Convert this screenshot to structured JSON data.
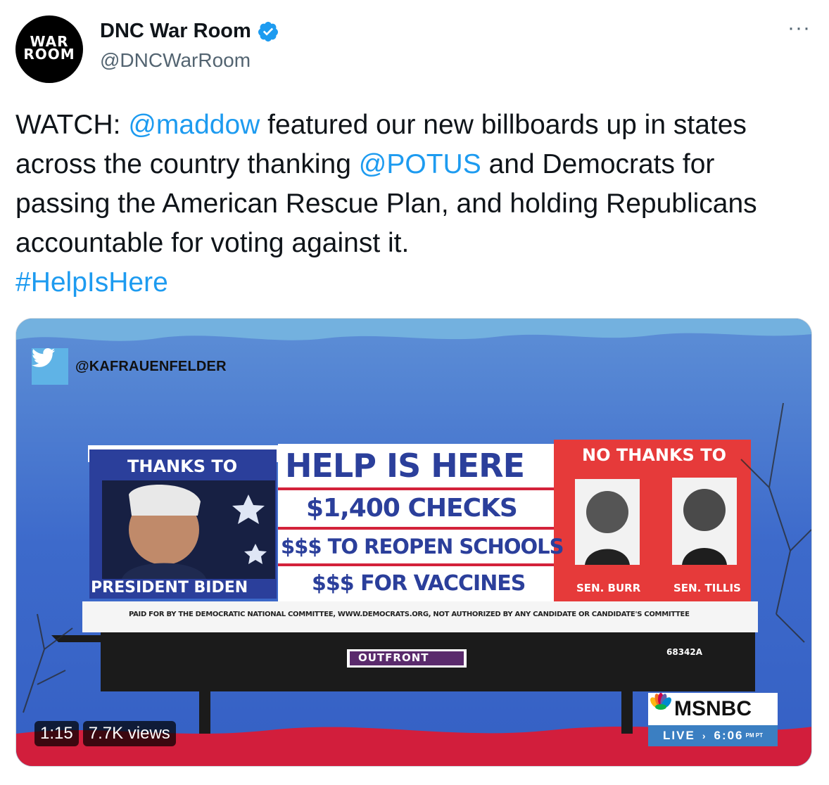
{
  "author": {
    "display_name": "DNC War Room",
    "handle": "@DNCWarRoom",
    "avatar_text_line1": "WAR",
    "avatar_text_line2": "ROOM",
    "verified_icon": "verified-badge-icon"
  },
  "more_menu_label": "···",
  "tweet": {
    "part1": "WATCH: ",
    "mention1": "@maddow",
    "part2": " featured our new billboards up in states across the country thanking ",
    "mention2": "@POTUS",
    "part3": " and Democrats for passing the American Rescue Plan, and holding Republicans accountable for voting against it.",
    "hashtag": "#HelpIsHere"
  },
  "media": {
    "watermark_handle": "@KAFRAUENFELDER",
    "billboard": {
      "thanks_to": "THANKS TO",
      "president": "PRESIDENT BIDEN",
      "headline": "HELP IS HERE",
      "line1": "$1,400 CHECKS",
      "line2": "$$$ TO REOPEN SCHOOLS",
      "line3": "$$$ FOR VACCINES",
      "no_thanks": "NO THANKS TO",
      "senator1": "SEN. BURR",
      "senator2": "SEN. TILLIS",
      "paid_for": "PAID FOR BY THE DEMOCRATIC NATIONAL COMMITTEE, WWW.DEMOCRATS.ORG, NOT AUTHORIZED BY ANY CANDIDATE OR CANDIDATE'S COMMITTEE",
      "vendor": "OUTFRONT",
      "panel_id": "68342A"
    },
    "network": "MSNBC",
    "live_label": "LIVE",
    "time": "6:06",
    "time_suffix": "PM PT",
    "duration": "1:15",
    "views": "7.7K views"
  },
  "colors": {
    "link": "#1d9bf0",
    "text": "#0f1419",
    "secondary": "#536471",
    "sky": "#3d67c9",
    "billboard_red": "#e63a3a",
    "billboard_blue": "#2b3f9b"
  }
}
